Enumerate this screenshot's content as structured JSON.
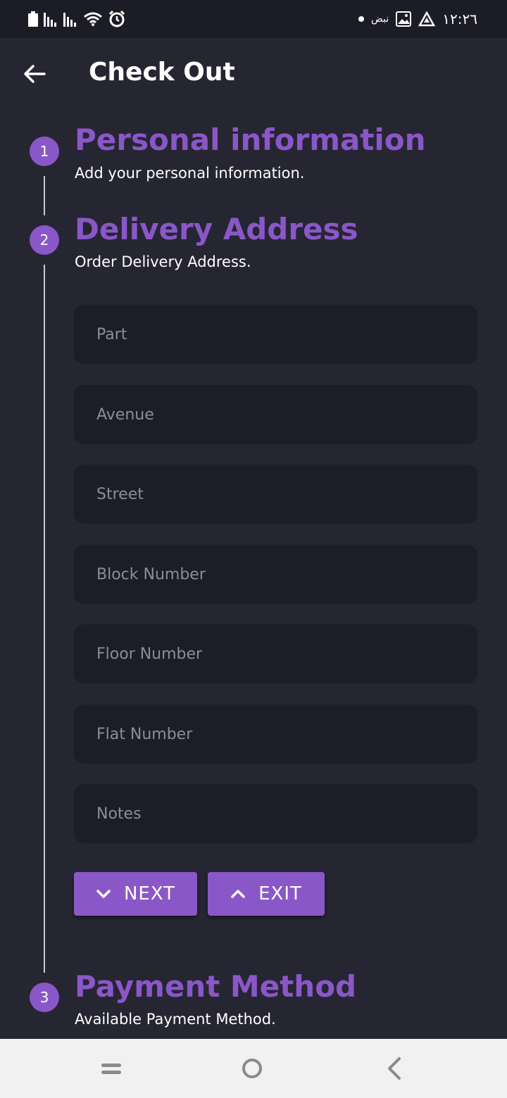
{
  "status_bar": {
    "time": "١٢:٢٦",
    "network_word": "نبض",
    "left_icons": [
      "battery-icon",
      "signal-icon",
      "signal-icon",
      "wifi-icon",
      "alarm-icon"
    ],
    "right_icons": [
      "dot-icon",
      "gallery-icon",
      "app-icon"
    ]
  },
  "app_bar": {
    "title": "Check Out",
    "back_icon": "arrow-left-icon"
  },
  "steps": [
    {
      "number": "1",
      "title": "Personal information",
      "subtitle": "Add your personal information."
    },
    {
      "number": "2",
      "title": "Delivery Address",
      "subtitle": "Order Delivery Address."
    },
    {
      "number": "3",
      "title": "Payment Method",
      "subtitle": "Available Payment Method."
    }
  ],
  "form": {
    "part_placeholder": "Part",
    "avenue_placeholder": "Avenue",
    "street_placeholder": "Street",
    "block_placeholder": "Block Number",
    "floor_placeholder": "Floor Number",
    "flat_placeholder": "Flat Number",
    "notes_placeholder": "Notes"
  },
  "buttons": {
    "next_label": "NEXT",
    "exit_label": "EXIT"
  },
  "nav_bar": {
    "icons": [
      "recent-apps-icon",
      "home-icon",
      "back-icon"
    ]
  },
  "colors": {
    "accent": "#8a57c8",
    "background": "#262633",
    "field_background": "#1d1d28",
    "nav_background": "#f1f1f1"
  }
}
